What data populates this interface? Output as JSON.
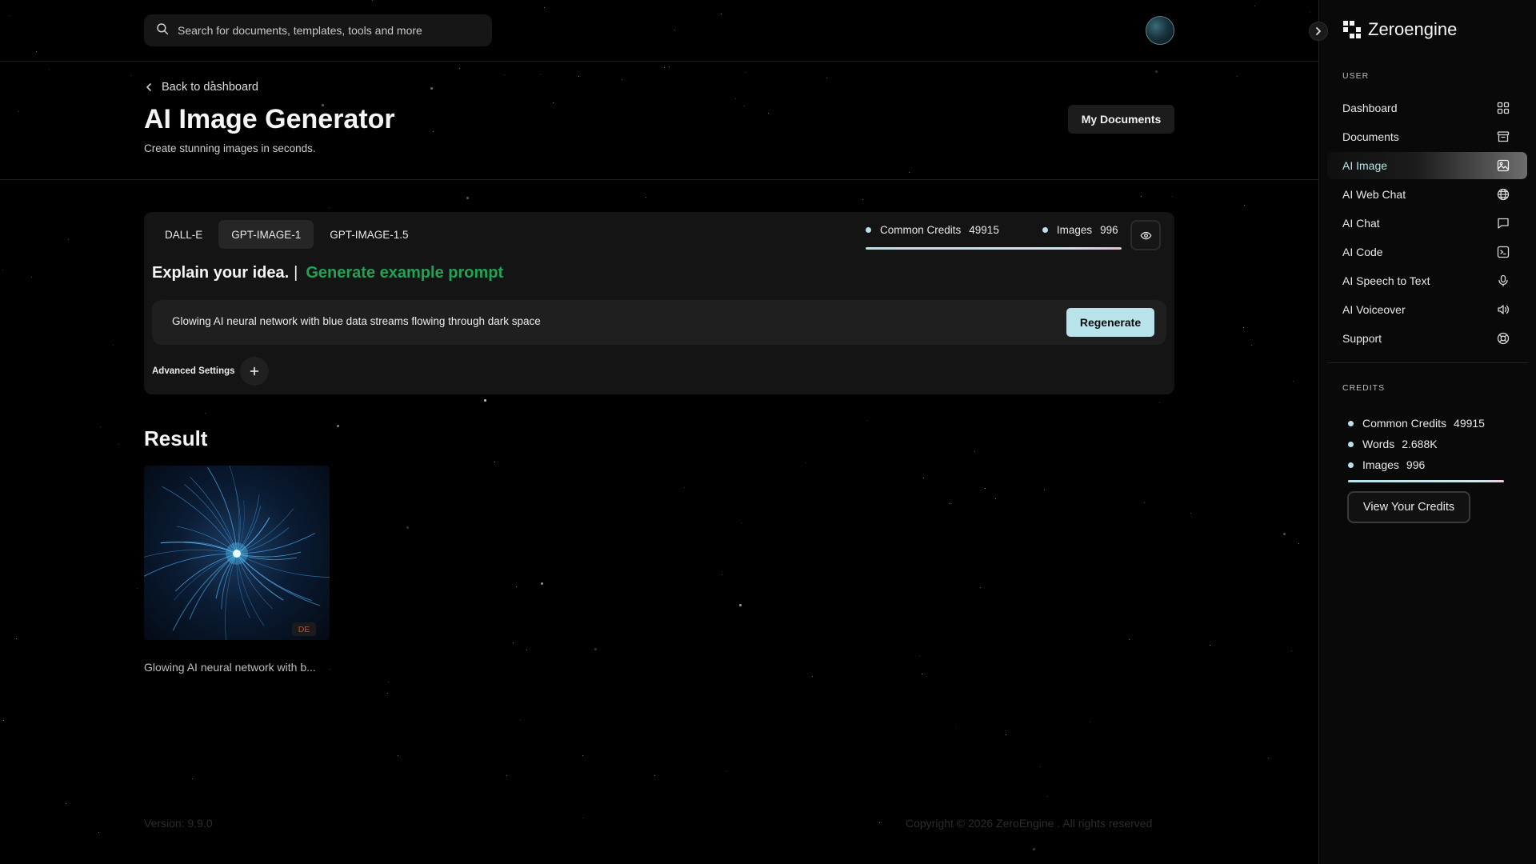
{
  "search": {
    "placeholder": "Search for documents, templates, tools and more"
  },
  "header": {
    "back_label": "Back to dashboard",
    "title": "AI Image Generator",
    "subtitle": "Create stunning images in seconds.",
    "my_documents_label": "My Documents"
  },
  "generator": {
    "tabs": [
      {
        "label": "DALL-E",
        "active": false
      },
      {
        "label": "GPT-IMAGE-1",
        "active": true
      },
      {
        "label": "GPT-IMAGE-1.5",
        "active": false
      }
    ],
    "credits": {
      "common_label": "Common Credits",
      "common_value": "49915",
      "images_label": "Images",
      "images_value": "996",
      "usage_fraction": 1.0
    },
    "idea_label": "Explain your idea.",
    "separator": "|",
    "example_prompt_label": "Generate example prompt",
    "prompt_value": "Glowing AI neural network with blue data streams flowing through dark space",
    "regenerate_label": "Regenerate",
    "advanced_settings_label": "Advanced Settings"
  },
  "result": {
    "title": "Result",
    "items": [
      {
        "badge": "DE",
        "caption": "Glowing AI neural network with b..."
      }
    ]
  },
  "footer": {
    "version": "Version: 9.9.0",
    "copyright": "Copyright © 2026 ZeroEngine . All rights reserved"
  },
  "sidebar": {
    "brand": "Zeroengine",
    "user_section_label": "USER",
    "items": [
      {
        "label": "Dashboard",
        "icon": "grid-icon",
        "active": false
      },
      {
        "label": "Documents",
        "icon": "archive-icon",
        "active": false
      },
      {
        "label": "AI Image",
        "icon": "image-icon",
        "active": true
      },
      {
        "label": "AI Web Chat",
        "icon": "globe-icon",
        "active": false
      },
      {
        "label": "AI Chat",
        "icon": "chat-icon",
        "active": false
      },
      {
        "label": "AI Code",
        "icon": "terminal-icon",
        "active": false
      },
      {
        "label": "AI Speech to Text",
        "icon": "microphone-icon",
        "active": false
      },
      {
        "label": "AI Voiceover",
        "icon": "speaker-icon",
        "active": false
      },
      {
        "label": "Support",
        "icon": "lifebuoy-icon",
        "active": false
      }
    ],
    "credits_section_label": "CREDITS",
    "credits": [
      {
        "label": "Common Credits",
        "value": "49915"
      },
      {
        "label": "Words",
        "value": "2.688K"
      },
      {
        "label": "Images",
        "value": "996"
      }
    ],
    "view_credits_label": "View Your Credits"
  },
  "colors": {
    "background": "#000000",
    "accent": "#b8e3ea",
    "example_prompt": "#21a355",
    "badge_text": "#d04040"
  }
}
